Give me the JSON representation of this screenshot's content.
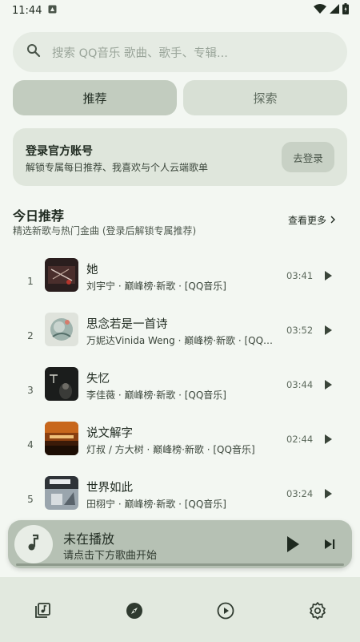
{
  "status": {
    "time": "11:44"
  },
  "search": {
    "placeholder": "搜索 QQ音乐 歌曲、歌手、专辑..."
  },
  "tabs": [
    {
      "label": "推荐",
      "active": true
    },
    {
      "label": "探索",
      "active": false
    }
  ],
  "login": {
    "title": "登录官方账号",
    "subtitle": "解锁专属每日推荐、我喜欢与个人云端歌单",
    "button": "去登录"
  },
  "today": {
    "title": "今日推荐",
    "subtitle": "精选新歌与热门金曲 (登录后解锁专属推荐)",
    "more": "查看更多"
  },
  "songs": [
    {
      "rank": "1",
      "title": "她",
      "meta": "刘宇宁 · 巅峰榜·新歌 · [QQ音乐]",
      "duration": "03:41"
    },
    {
      "rank": "2",
      "title": "思念若是一首诗",
      "meta": "万妮达Vinida Weng · 巅峰榜·新歌 · [QQ音乐]",
      "duration": "03:52"
    },
    {
      "rank": "3",
      "title": "失忆",
      "meta": "李佳薇 · 巅峰榜·新歌 · [QQ音乐]",
      "duration": "03:44"
    },
    {
      "rank": "4",
      "title": "说文解字",
      "meta": "灯叔 / 方大树 · 巅峰榜·新歌 · [QQ音乐]",
      "duration": "02:44"
    },
    {
      "rank": "5",
      "title": "世界如此",
      "meta": "田栩宁 · 巅峰榜·新歌 · [QQ音乐]",
      "duration": "03:24"
    }
  ],
  "player": {
    "title": "未在播放",
    "subtitle": "请点击下方歌曲开始"
  },
  "colors": {
    "background": "#f3f7f2",
    "accent": "#c2ccbf",
    "text": "#1f2a20"
  }
}
